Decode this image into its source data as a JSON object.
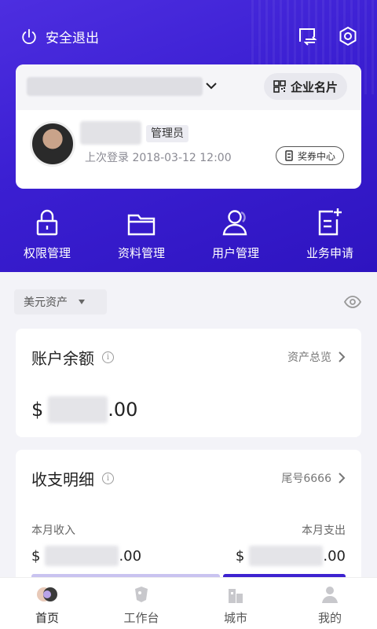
{
  "header": {
    "logout_label": "安全退出",
    "icons": [
      "power-icon",
      "switch-account-icon",
      "settings-icon"
    ]
  },
  "company_card": {
    "card_button_label": "企业名片",
    "role_badge": "管理员",
    "last_login": "上次登录 2018-03-12 12:00",
    "voucher_label": "奖券中心"
  },
  "shortcuts": [
    {
      "label": "权限管理",
      "icon": "lock-icon"
    },
    {
      "label": "资料管理",
      "icon": "folder-icon"
    },
    {
      "label": "用户管理",
      "icon": "user-icon"
    },
    {
      "label": "业务申请",
      "icon": "document-add-icon"
    }
  ],
  "currency_select": {
    "value": "美元资产"
  },
  "balance": {
    "title": "账户余额",
    "overview_link": "资产总览",
    "currency_symbol": "$",
    "decimal": ".00"
  },
  "detail": {
    "title": "收支明细",
    "account_tail": "尾号6666",
    "income_label": "本月收入",
    "expense_label": "本月支出",
    "currency_symbol": "$",
    "decimal": ".00"
  },
  "tabbar": [
    {
      "label": "首页",
      "icon": "home-icon",
      "active": true
    },
    {
      "label": "工作台",
      "icon": "workbench-icon",
      "active": false
    },
    {
      "label": "城市",
      "icon": "city-icon",
      "active": false
    },
    {
      "label": "我的",
      "icon": "profile-icon",
      "active": false
    }
  ],
  "colors": {
    "primary": "#3b1fd2",
    "background": "#f3f3f8",
    "income_bar": "#c9c3f0",
    "expense_bar": "#3d22d0"
  }
}
